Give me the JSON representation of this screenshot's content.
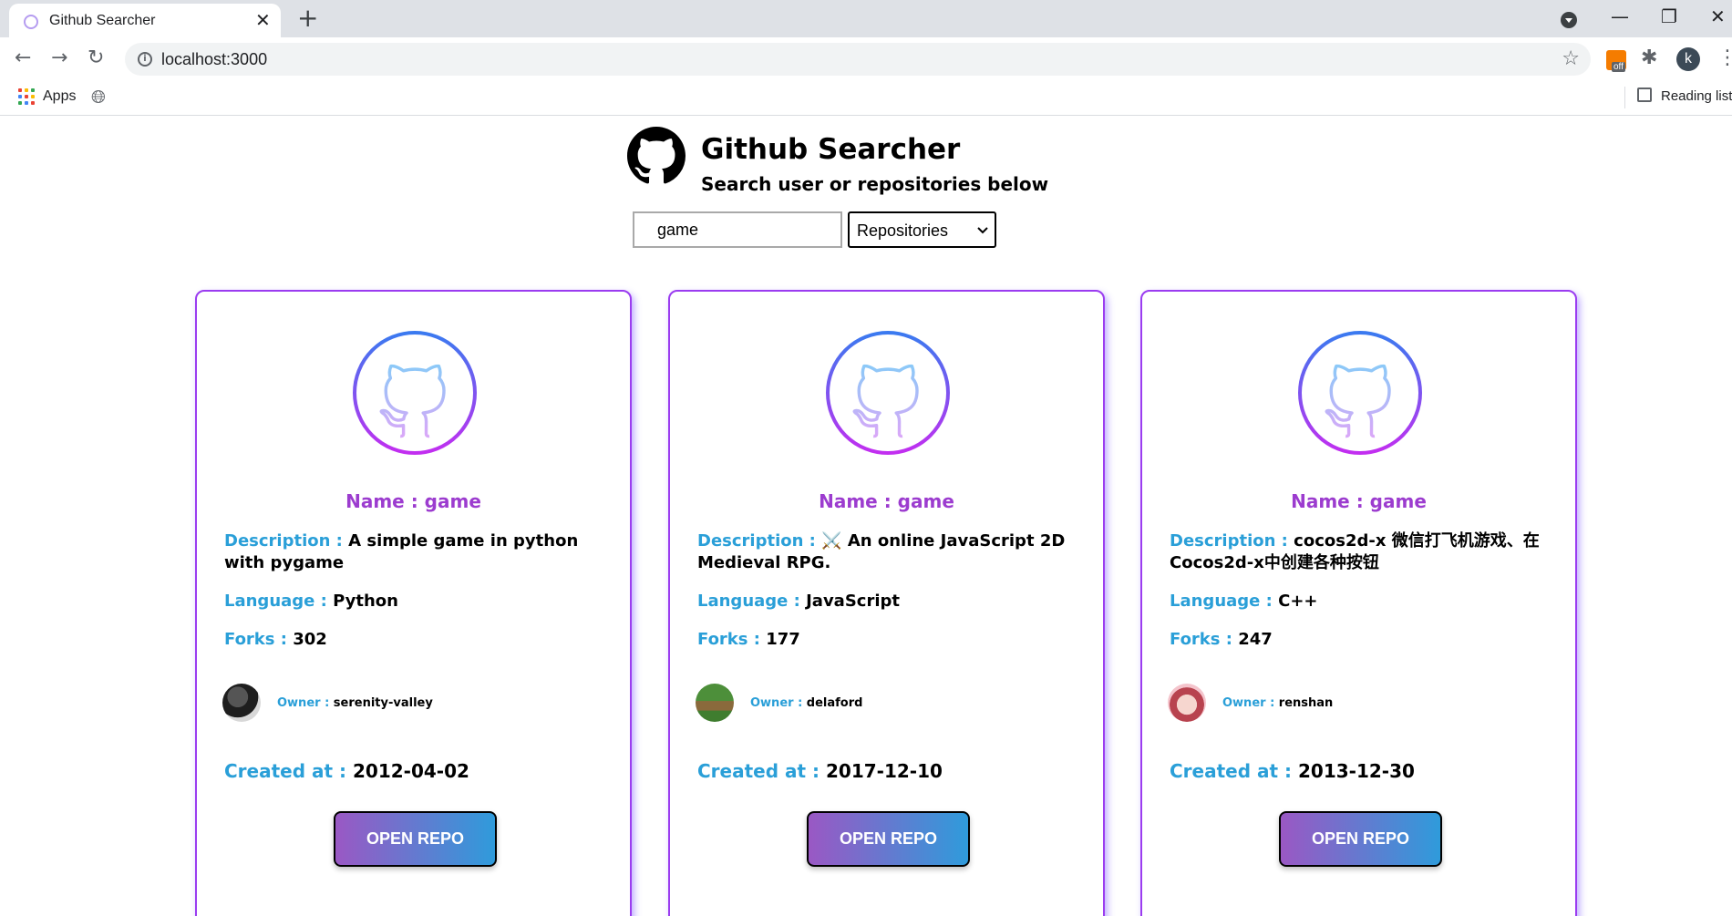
{
  "browser": {
    "tab_title": "Github Searcher",
    "url": "localhost:3000",
    "bookmarks": {
      "apps_label": "Apps",
      "reading_list_label": "Reading list"
    },
    "profile_initial": "k",
    "extension_badge": "off"
  },
  "header": {
    "title": "Github Searcher",
    "subtitle": "Search user or repositories below"
  },
  "search": {
    "value": "game",
    "type_selected": "Repositories"
  },
  "labels": {
    "name": "Name : ",
    "description": "Description : ",
    "language": "Language : ",
    "forks": "Forks : ",
    "owner": "Owner : ",
    "created": "Created at : ",
    "open_button": "OPEN REPO"
  },
  "repos": [
    {
      "name": "game",
      "description": "A simple game in python with pygame",
      "language": "Python",
      "forks": "302",
      "owner": "serenity-valley",
      "created": "2012-04-02"
    },
    {
      "name": "game",
      "description": "⚔️ An online JavaScript 2D Medieval RPG.",
      "language": "JavaScript",
      "forks": "177",
      "owner": "delaford",
      "created": "2017-12-10"
    },
    {
      "name": "game",
      "description": "cocos2d-x 微信打飞机游戏、在Cocos2d-x中创建各种按钮",
      "language": "C++",
      "forks": "247",
      "owner": "renshan",
      "created": "2013-12-30"
    }
  ],
  "colors": {
    "card_border": "#9b3cf0",
    "name_purple": "#9c3ccf",
    "label_blue": "#2a9fd8"
  }
}
